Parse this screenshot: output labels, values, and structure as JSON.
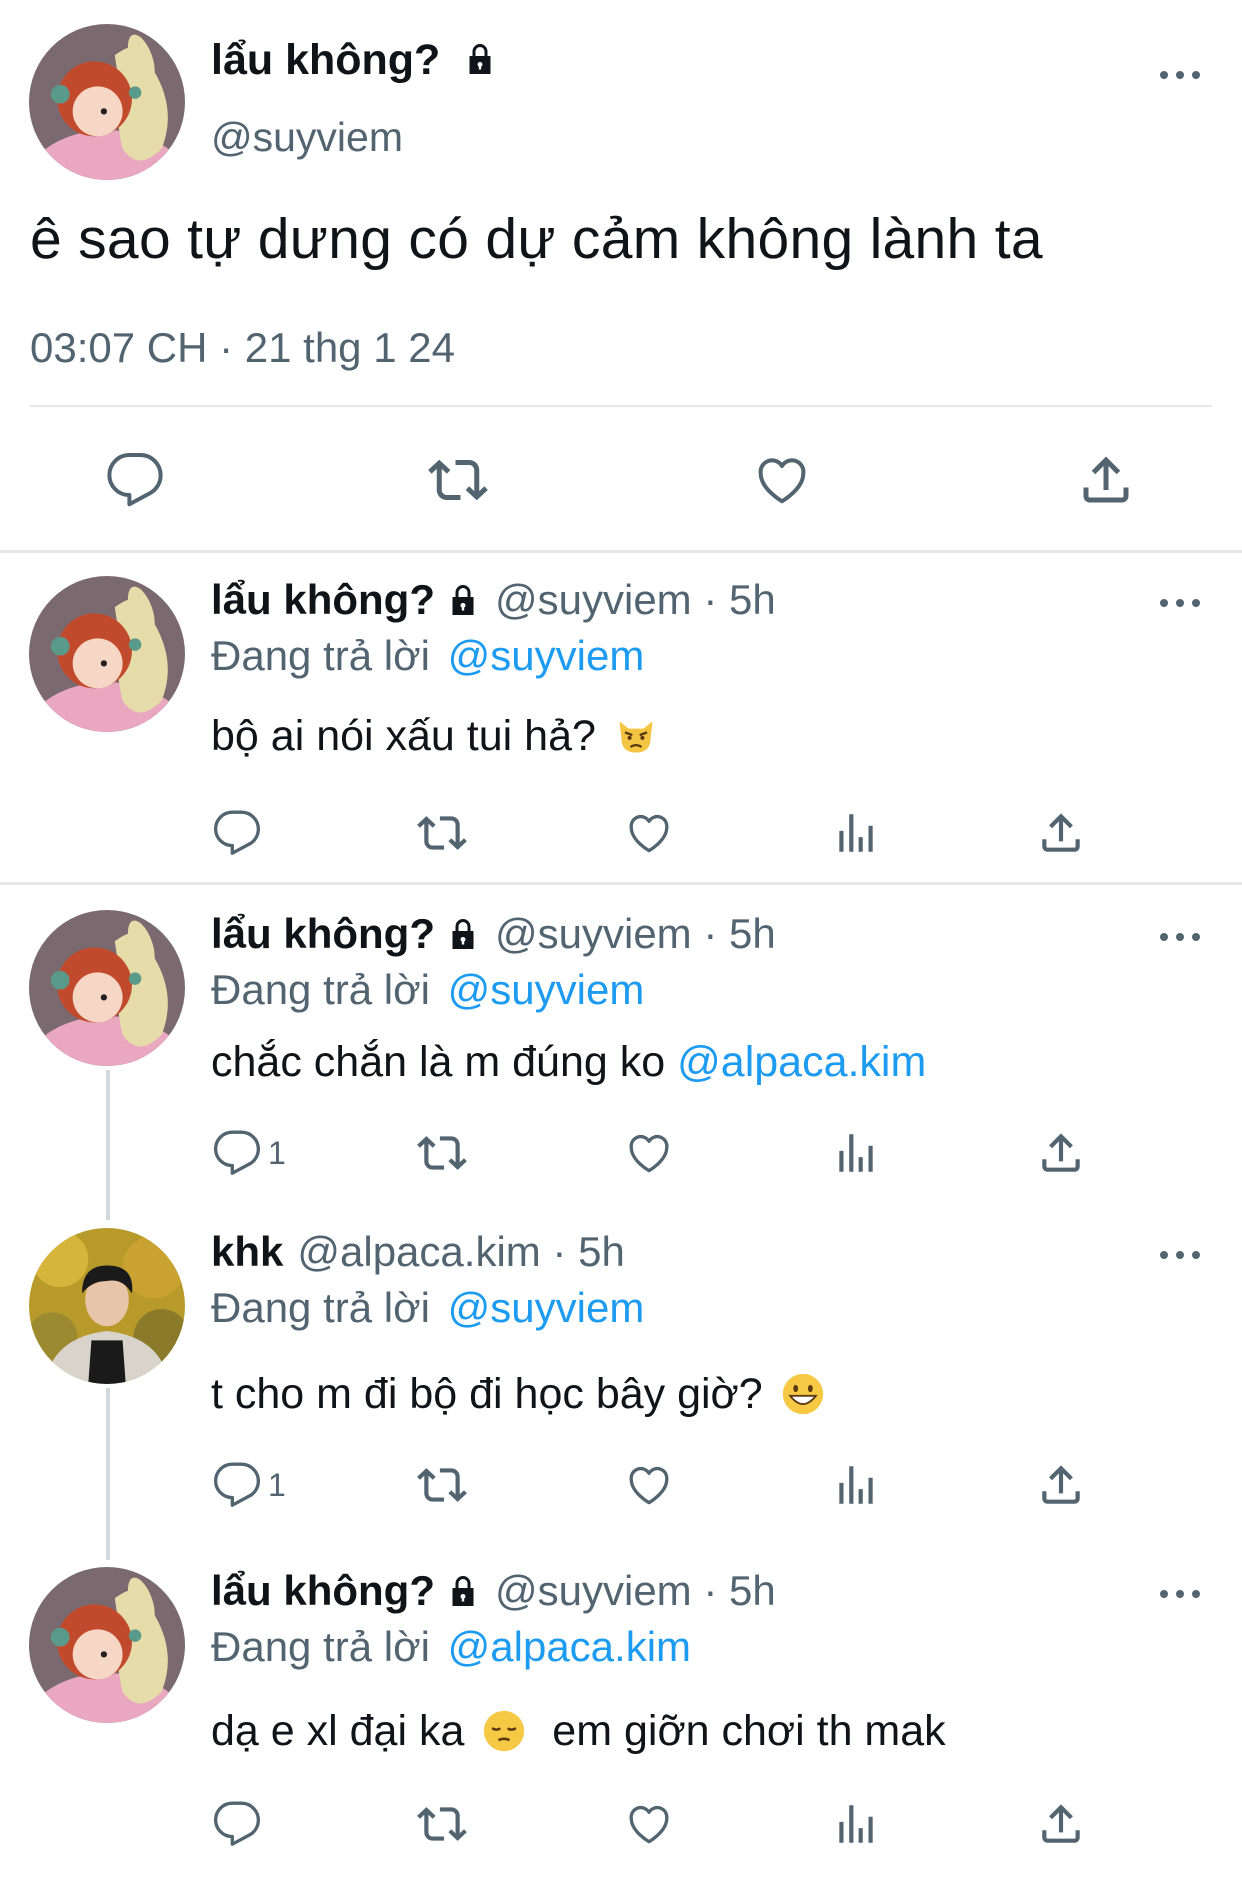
{
  "main_tweet": {
    "display_name": "lẩu không?",
    "handle": "@suyviem",
    "text": "ê sao tự dưng có dự cảm không lành ta",
    "timestamp": "03:07 CH · 21 thg 1 24",
    "icons": [
      "lock-icon",
      "more-icon",
      "reply-icon",
      "retweet-icon",
      "like-icon",
      "share-icon"
    ]
  },
  "replies": [
    {
      "display_name": "lẩu không?",
      "meta": "@suyviem · 5h",
      "replying_label": "Đang trả lời",
      "replying_to": "@suyviem",
      "text": "bộ ai nói xấu tui hả?",
      "emoji": "pouting-cat-emoji",
      "reply_count": ""
    },
    {
      "display_name": "lẩu không?",
      "meta": "@suyviem · 5h",
      "replying_label": "Đang trả lời",
      "replying_to": "@suyviem",
      "text": "chắc chắn là m đúng ko",
      "text_mention": "@alpaca.kim",
      "reply_count": "1"
    },
    {
      "display_name": "khk",
      "meta": "@alpaca.kim · 5h",
      "replying_label": "Đang trả lời",
      "replying_to": "@suyviem",
      "text": "t cho m đi bộ đi học bây giờ?",
      "emoji": "grinning-face-emoji",
      "reply_count": "1"
    },
    {
      "display_name": "lẩu không?",
      "meta": "@suyviem · 5h",
      "replying_label": "Đang trả lời",
      "replying_to": "@alpaca.kim",
      "text": "dạ e xl đại ka",
      "emoji": "pensive-face-emoji",
      "text_after": "em giỡn chơi th mak",
      "reply_count": ""
    }
  ],
  "colors": {
    "text": "#0f1419",
    "secondary": "#536471",
    "link": "#1d9bf0",
    "divider": "#e6e9eb"
  }
}
